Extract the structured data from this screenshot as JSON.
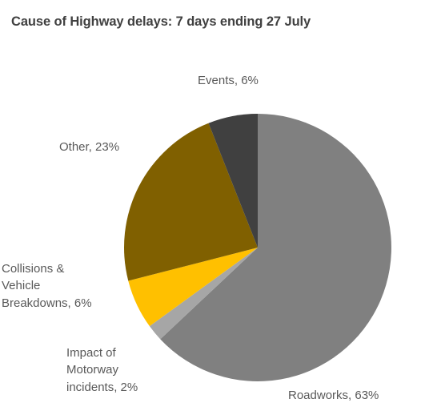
{
  "chart_data": {
    "type": "pie",
    "title": "Cause of Highway delays: 7 days ending 27 July",
    "xlabel": "",
    "ylabel": "",
    "legend_position": "none",
    "grid": false,
    "labels_format": "{name}, {percent}%",
    "categories": [
      "Roadworks",
      "Impact of Motorway incidents",
      "Collisions & Vehicle Breakdowns",
      "Other",
      "Events"
    ],
    "values": [
      63,
      2,
      6,
      23,
      6
    ],
    "units": "percent",
    "colors": [
      "#808080",
      "#a6a6a6",
      "#ffc000",
      "#806000",
      "#404040"
    ],
    "slices": [
      {
        "name": "Roadworks",
        "percent": 63,
        "color": "#808080",
        "label": "Roadworks, 63%",
        "label_lines": [
          "Roadworks, 63%"
        ]
      },
      {
        "name": "Impact of Motorway incidents",
        "percent": 2,
        "color": "#a6a6a6",
        "label": "Impact of Motorway incidents, 2%",
        "label_lines": [
          "Impact of",
          "Motorway",
          "incidents, 2%"
        ]
      },
      {
        "name": "Collisions & Vehicle Breakdowns",
        "percent": 6,
        "color": "#ffc000",
        "label": "Collisions & Vehicle Breakdowns, 6%",
        "label_lines": [
          "Collisions &",
          "Vehicle",
          "Breakdowns, 6%"
        ]
      },
      {
        "name": "Other",
        "percent": 23,
        "color": "#806000",
        "label": "Other, 23%",
        "label_lines": [
          "Other, 23%"
        ]
      },
      {
        "name": "Events",
        "percent": 6,
        "color": "#404040",
        "label": "Events, 6%",
        "label_lines": [
          "Events, 6%"
        ]
      }
    ]
  },
  "labels": {
    "events": "Events, 6%",
    "other": "Other, 23%",
    "collisions": "Collisions &\nVehicle\nBreakdowns, 6%",
    "impact": "Impact of\nMotorway\nincidents, 2%",
    "roadworks": "Roadworks, 63%"
  },
  "colors": {
    "title_text": "#404040",
    "label_text": "#595959",
    "background": "#ffffff",
    "roadworks": "#808080",
    "impact": "#a6a6a6",
    "collisions": "#ffc000",
    "other": "#806000",
    "events": "#404040"
  }
}
